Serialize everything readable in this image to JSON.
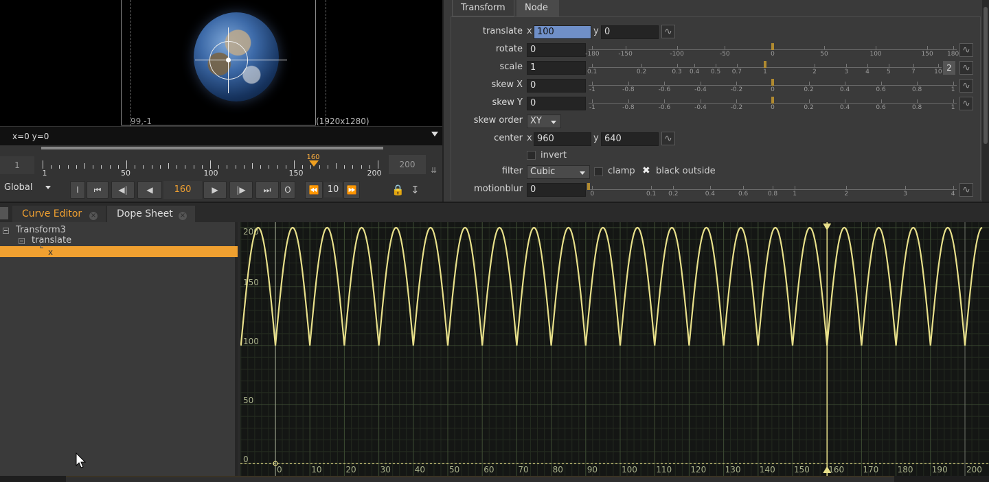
{
  "viewer": {
    "corner_label": "99,-1",
    "format_label": "(1920x1280)",
    "info": "x=0 y=0"
  },
  "timeline": {
    "first_frame": "1",
    "last_frame": "200",
    "current_frame": "160",
    "tick_labels": [
      "1",
      "50",
      "100",
      "150",
      "200"
    ],
    "scope": "Global",
    "frame_field": "160",
    "increment": "10",
    "buttons": [
      "I",
      "O"
    ]
  },
  "properties": {
    "tabs": [
      "Transform",
      "Node"
    ],
    "translate": {
      "label": "translate",
      "x": "100",
      "y": "0"
    },
    "rotate": {
      "label": "rotate",
      "value": "0",
      "ticks": [
        "-180",
        "-150",
        "-100",
        "-50",
        "0",
        "50",
        "100",
        "150",
        "180"
      ]
    },
    "scale": {
      "label": "scale",
      "value": "1",
      "badge": "2",
      "ticks": [
        "0.1",
        "0.2",
        "0.3",
        "0.4",
        "0.5",
        "0.7",
        "1",
        "2",
        "3",
        "4",
        "5",
        "7",
        "10"
      ]
    },
    "skewX": {
      "label": "skew X",
      "value": "0",
      "ticks": [
        "-1",
        "-0.8",
        "-0.6",
        "-0.4",
        "-0.2",
        "0",
        "0.2",
        "0.4",
        "0.6",
        "0.8",
        "1"
      ]
    },
    "skewY": {
      "label": "skew Y",
      "value": "0",
      "ticks": [
        "-1",
        "-0.8",
        "-0.6",
        "-0.4",
        "-0.2",
        "0",
        "0.2",
        "0.4",
        "0.6",
        "0.8",
        "1"
      ]
    },
    "skew_order": {
      "label": "skew order",
      "value": "XY"
    },
    "center": {
      "label": "center",
      "x": "960",
      "y": "640"
    },
    "invert": {
      "label": "invert",
      "checked": false
    },
    "filter": {
      "label": "filter",
      "value": "Cubic"
    },
    "clamp": {
      "label": "clamp",
      "checked": false
    },
    "black_outside": {
      "label": "black outside",
      "checked": true
    },
    "motionblur": {
      "label": "motionblur",
      "value": "0",
      "ticks": [
        "0",
        "0.1",
        "0.2",
        "0.4",
        "0.6",
        "0.8",
        "1",
        "2",
        "3",
        "4"
      ]
    }
  },
  "lower_tabs": [
    "Curve Editor",
    "Dope Sheet"
  ],
  "tree": {
    "node": "Transform3",
    "param": "translate",
    "channel": "x"
  },
  "chart_data": {
    "type": "line",
    "title": "",
    "xlabel": "",
    "ylabel": "",
    "xlim": [
      -10,
      205
    ],
    "ylim": [
      0,
      200
    ],
    "x_ticks": [
      0,
      10,
      20,
      30,
      40,
      50,
      60,
      70,
      80,
      90,
      100,
      110,
      120,
      130,
      140,
      150,
      160,
      170,
      180,
      190,
      200
    ],
    "y_ticks": [
      0,
      50,
      100,
      150,
      200
    ],
    "current_frame": 160,
    "curve_color": "#e8e08a",
    "period": 10,
    "series": [
      {
        "values_description_free": true,
        "x": [
          -10,
          -5,
          0,
          5,
          10,
          15,
          20,
          25,
          30,
          35,
          40,
          45,
          50,
          55,
          60,
          65,
          70,
          75,
          80,
          85,
          90,
          95,
          100,
          105,
          110,
          115,
          120,
          125,
          130,
          135,
          140,
          145,
          150,
          155,
          160,
          165,
          170,
          175,
          180,
          185,
          190,
          195,
          200,
          205
        ],
        "y": [
          100,
          200,
          100,
          200,
          100,
          200,
          100,
          200,
          100,
          200,
          100,
          200,
          100,
          200,
          100,
          200,
          100,
          200,
          100,
          200,
          100,
          200,
          100,
          200,
          100,
          200,
          100,
          200,
          100,
          200,
          100,
          200,
          100,
          200,
          100,
          200,
          100,
          200,
          100,
          200,
          100,
          200,
          100,
          200
        ]
      }
    ]
  },
  "colors": {
    "accent": "#f0a030",
    "curve": "#e8e08a",
    "grid_major": "#3c4a32",
    "grid_minor": "#232a1f",
    "selection": "#6f8fc8"
  }
}
